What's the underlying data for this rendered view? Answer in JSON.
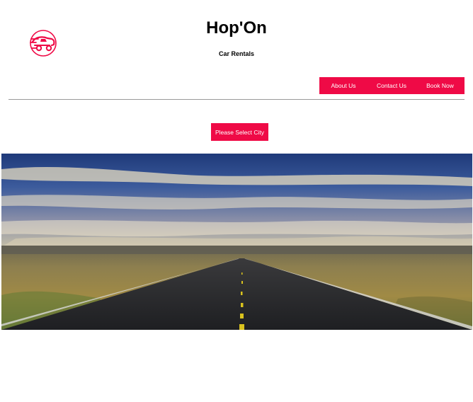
{
  "header": {
    "title": "Hop'On",
    "subtitle": "Car Rentals",
    "logo_icon": "car-logo-icon"
  },
  "nav": {
    "items": [
      {
        "label": "About Us"
      },
      {
        "label": "Contact Us"
      },
      {
        "label": "Book Now"
      }
    ]
  },
  "city_selector": {
    "label": "Please Select City"
  },
  "hero": {
    "image": "desert-highway-landscape"
  },
  "colors": {
    "accent": "#ef0a46",
    "background": "#ffffff",
    "divider": "#9a9a9a"
  }
}
